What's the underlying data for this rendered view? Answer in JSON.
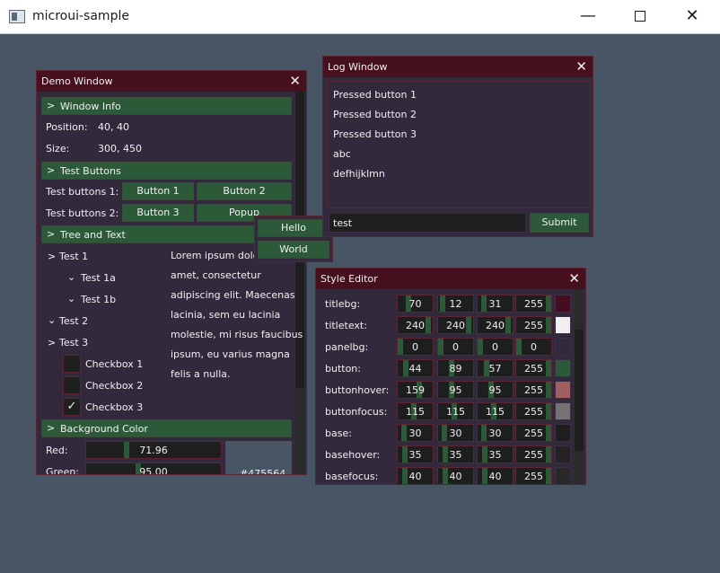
{
  "app": {
    "title": "microui-sample",
    "minimize": "—",
    "close": "✕"
  },
  "demo": {
    "title": "Demo Window",
    "close": "✕",
    "window_info": {
      "header": "Window Info",
      "position_label": "Position:",
      "position_value": "40, 40",
      "size_label": "Size:",
      "size_value": "300, 450"
    },
    "test_buttons": {
      "header": "Test Buttons",
      "row1_label": "Test buttons 1:",
      "row2_label": "Test buttons 2:",
      "button1": "Button 1",
      "button2": "Button 2",
      "button3": "Button 3",
      "popup": "Popup"
    },
    "tree": {
      "header": "Tree and Text",
      "test1": "Test 1",
      "test1a": "Test 1a",
      "test1b": "Test 1b",
      "test2": "Test 2",
      "test3": "Test 3",
      "checkbox1": "Checkbox 1",
      "checkbox2": "Checkbox 2",
      "checkbox3": "Checkbox 3",
      "lorem_lines": [
        "Lorem ipsum dolor sit",
        "amet, consectetur",
        "adipiscing elit. Maecenas",
        "lacinia, sem eu lacinia",
        "molestie, mi risus faucibus",
        "ipsum, eu varius magna",
        "felis a nulla."
      ]
    },
    "background": {
      "header": "Background Color",
      "red_label": "Red:",
      "red_value": "71.96",
      "green_label": "Green:",
      "green_value": "95.00",
      "hex": "#475564"
    }
  },
  "popup": {
    "hello": "Hello",
    "world": "World"
  },
  "log": {
    "title": "Log Window",
    "close": "✕",
    "lines": [
      "Pressed button 1",
      "Pressed button 2",
      "Pressed button 3",
      "abc",
      "defhijklmn"
    ],
    "input_value": "test",
    "submit": "Submit"
  },
  "style": {
    "title": "Style Editor",
    "close": "✕",
    "rows": [
      {
        "label": "titlebg:",
        "values": [
          "70",
          "12",
          "31",
          "255"
        ],
        "color": "#460c1f"
      },
      {
        "label": "titletext:",
        "values": [
          "240",
          "240",
          "240",
          "255"
        ],
        "color": "#f0f0f0"
      },
      {
        "label": "panelbg:",
        "values": [
          "0",
          "0",
          "0",
          "0"
        ],
        "color": ""
      },
      {
        "label": "button:",
        "values": [
          "44",
          "89",
          "57",
          "255"
        ],
        "color": "#2c5939"
      },
      {
        "label": "buttonhover:",
        "values": [
          "159",
          "95",
          "95",
          "255"
        ],
        "color": "#9f5f5f"
      },
      {
        "label": "buttonfocus:",
        "values": [
          "115",
          "115",
          "115",
          "255"
        ],
        "color": "#737373"
      },
      {
        "label": "base:",
        "values": [
          "30",
          "30",
          "30",
          "255"
        ],
        "color": "#1e1e1e"
      },
      {
        "label": "basehover:",
        "values": [
          "35",
          "35",
          "35",
          "255"
        ],
        "color": "#232323"
      },
      {
        "label": "basefocus:",
        "values": [
          "40",
          "40",
          "40",
          "255"
        ],
        "color": "#282828"
      }
    ]
  }
}
